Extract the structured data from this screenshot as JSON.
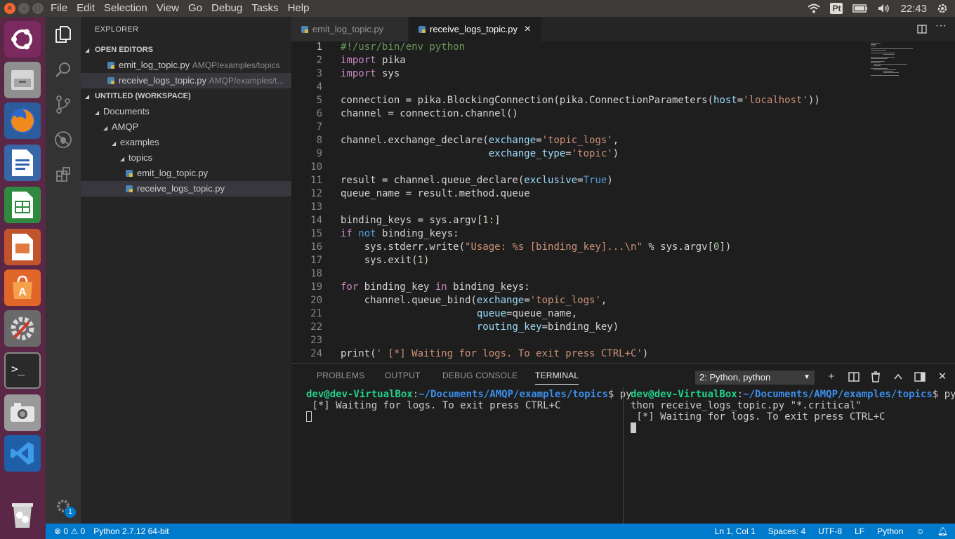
{
  "menu": [
    "File",
    "Edit",
    "Selection",
    "View",
    "Go",
    "Debug",
    "Tasks",
    "Help"
  ],
  "tray": {
    "keyboard": "Pt",
    "time": "22:43"
  },
  "sidebar": {
    "title": "EXPLORER",
    "open_editors_label": "OPEN EDITORS",
    "open_editors": [
      {
        "name": "emit_log_topic.py",
        "path": "AMQP/examples/topics"
      },
      {
        "name": "receive_logs_topic.py",
        "path": "AMQP/examples/t..."
      }
    ],
    "workspace_label": "UNTITLED (WORKSPACE)",
    "tree": [
      "Documents",
      "AMQP",
      "examples",
      "topics",
      "emit_log_topic.py",
      "receive_logs_topic.py"
    ]
  },
  "tabs": [
    {
      "label": "emit_log_topic.py"
    },
    {
      "label": "receive_logs_topic.py",
      "close": "×"
    }
  ],
  "editor": {
    "line_numbers": [
      "1",
      "2",
      "3",
      "4",
      "5",
      "6",
      "7",
      "8",
      "9",
      "10",
      "11",
      "12",
      "13",
      "14",
      "15",
      "16",
      "17",
      "18",
      "19",
      "20",
      "21",
      "22",
      "23",
      "24"
    ],
    "code_text": [
      "#!/usr/bin/env python",
      "import pika",
      "import sys",
      "",
      "connection = pika.BlockingConnection(pika.ConnectionParameters(host='localhost'))",
      "channel = connection.channel()",
      "",
      "channel.exchange_declare(exchange='topic_logs',",
      "                         exchange_type='topic')",
      "",
      "result = channel.queue_declare(exclusive=True)",
      "queue_name = result.method.queue",
      "",
      "binding_keys = sys.argv[1:]",
      "if not binding_keys:",
      "    sys.stderr.write(\"Usage: %s [binding_key]...\\n\" % sys.argv[0])",
      "    sys.exit(1)",
      "",
      "for binding_key in binding_keys:",
      "    channel.queue_bind(exchange='topic_logs',",
      "                       queue=queue_name,",
      "                       routing_key=binding_key)",
      "",
      "print(' [*] Waiting for logs. To exit press CTRL+C')"
    ]
  },
  "panel": {
    "tabs": [
      "PROBLEMS",
      "OUTPUT",
      "DEBUG CONSOLE",
      "TERMINAL"
    ],
    "terminal_select": "2: Python, python",
    "term1": {
      "user": "dev@dev-VirtualBox",
      "path": "~/Documents/AMQP/examples/topics",
      "prompt_tail": "$ py",
      "line2": " [*] Waiting for logs. To exit press CTRL+C"
    },
    "term2": {
      "user": "dev@dev-VirtualBox",
      "path": "~/Documents/AMQP/examples/topics",
      "prompt_tail": "$ py",
      "line2": "thon receive_logs_topic.py \"*.critical\"",
      "line3": " [*] Waiting for logs. To exit press CTRL+C"
    }
  },
  "status": {
    "errors": "0",
    "warnings": "0",
    "interpreter": "Python 2.7.12 64-bit",
    "position": "Ln 1, Col 1",
    "spaces": "Spaces: 4",
    "encoding": "UTF-8",
    "eol": "LF",
    "language": "Python"
  },
  "settings_badge": "1"
}
